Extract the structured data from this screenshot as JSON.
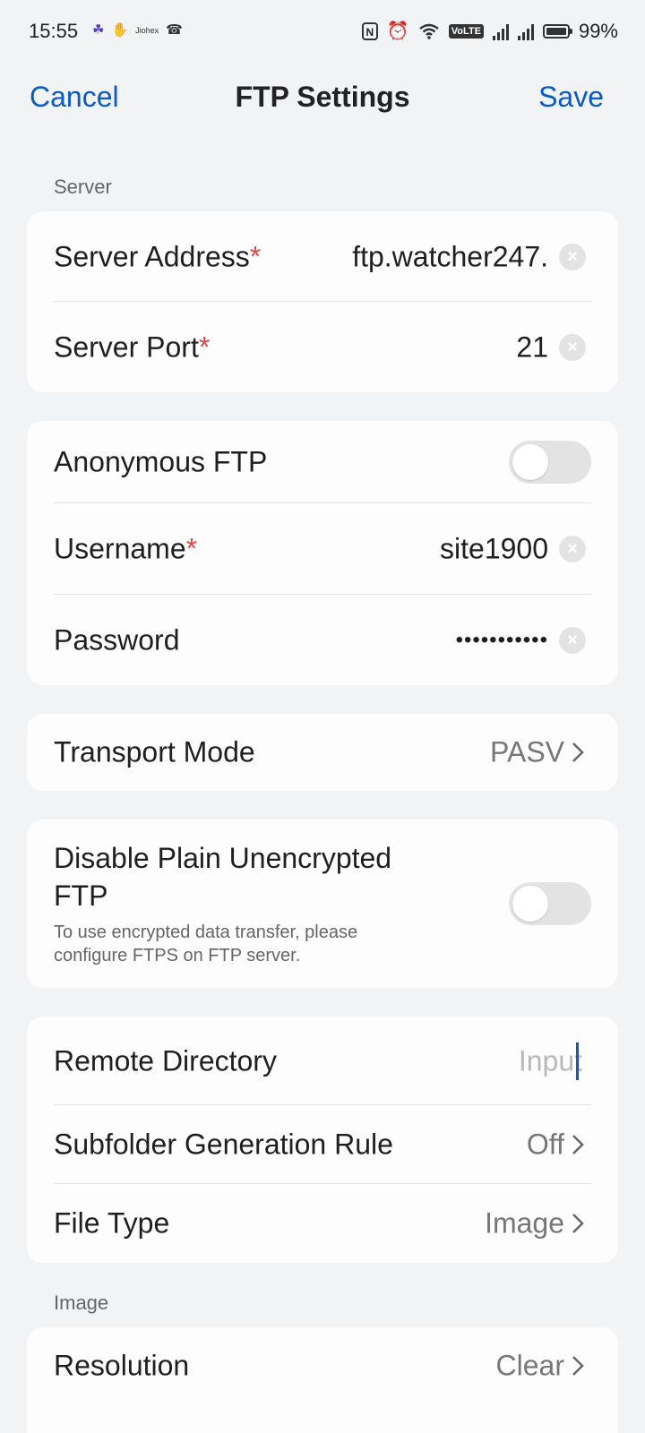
{
  "status_bar": {
    "time": "15:55",
    "left_icons": [
      "app-icon",
      "hand-icon",
      "jiohex-icon",
      "wifi-calling-icon"
    ],
    "jiohex_text": "Jiohex",
    "nfc_text": "N",
    "volte_text": "VoLTE",
    "battery_text": "99%",
    "battery_level": 0.99
  },
  "nav": {
    "cancel": "Cancel",
    "title": "FTP Settings",
    "save": "Save",
    "accent_color": "#0a59c9"
  },
  "server_section": {
    "label": "Server",
    "address_label": "Server Address",
    "address_value": "ftp.watcher247.",
    "port_label": "Server Port",
    "port_value": "21",
    "required_mark": "*"
  },
  "auth_section": {
    "anonymous_label": "Anonymous FTP",
    "anonymous_on": false,
    "username_label": "Username",
    "username_value": "site1900",
    "password_label": "Password",
    "password_value": "•••••••••••"
  },
  "transport": {
    "label": "Transport Mode",
    "value": "PASV"
  },
  "encryption": {
    "label_line1": "Disable Plain Unencrypted",
    "label_line2": "FTP",
    "hint_line1": "To use encrypted data transfer, please",
    "hint_line2": "configure FTPS on FTP server.",
    "enabled": false
  },
  "directory_section": {
    "remote_label": "Remote Directory",
    "remote_placeholder": "Input",
    "subfolder_label": "Subfolder Generation Rule",
    "subfolder_value": "Off",
    "filetype_label": "File Type",
    "filetype_value": "Image"
  },
  "image_section": {
    "label": "Image",
    "resolution_label": "Resolution",
    "resolution_value": "Clear"
  }
}
